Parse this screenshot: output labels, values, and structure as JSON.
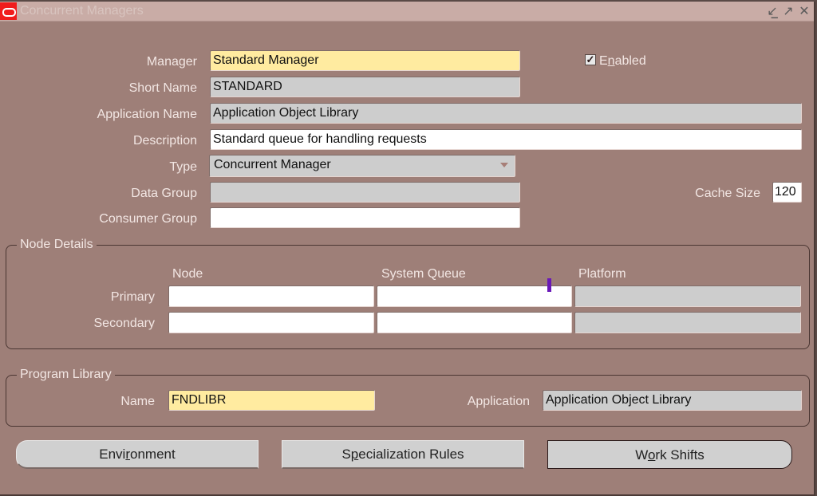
{
  "window": {
    "title": "Concurrent Managers",
    "controls": {
      "minimize_icon": "minimize-icon",
      "maximize_icon": "maximize-icon",
      "close_icon": "close-icon"
    }
  },
  "form": {
    "manager": {
      "label": "Manager",
      "value": "Standard Manager"
    },
    "enabled": {
      "label": "Enabled",
      "checked": true,
      "mnemonic": "n"
    },
    "short_name": {
      "label": "Short Name",
      "value": "STANDARD"
    },
    "application_name": {
      "label": "Application Name",
      "value": "Application Object Library"
    },
    "description": {
      "label": "Description",
      "value": "Standard queue for handling requests"
    },
    "type": {
      "label": "Type",
      "value": "Concurrent Manager"
    },
    "data_group": {
      "label": "Data Group",
      "value": ""
    },
    "cache_size": {
      "label": "Cache Size",
      "value": "120"
    },
    "consumer_group": {
      "label": "Consumer Group",
      "value": ""
    }
  },
  "node_details": {
    "title": "Node Details",
    "columns": [
      "Node",
      "System Queue",
      "Platform"
    ],
    "rows": [
      {
        "label": "Primary",
        "node": "",
        "system_queue": "",
        "platform": ""
      },
      {
        "label": "Secondary",
        "node": "",
        "system_queue": "",
        "platform": ""
      }
    ]
  },
  "program_library": {
    "title": "Program Library",
    "name": {
      "label": "Name",
      "value": "FNDLIBR"
    },
    "application": {
      "label": "Application",
      "value": "Application Object Library"
    }
  },
  "buttons": {
    "environment": {
      "pre": "Envi",
      "mn": "r",
      "post": "onment"
    },
    "specialization_rules": {
      "pre": "S",
      "mn": "p",
      "post": "ecialization Rules"
    },
    "work_shifts": {
      "pre": "W",
      "mn": "o",
      "post": "rk Shifts"
    }
  }
}
